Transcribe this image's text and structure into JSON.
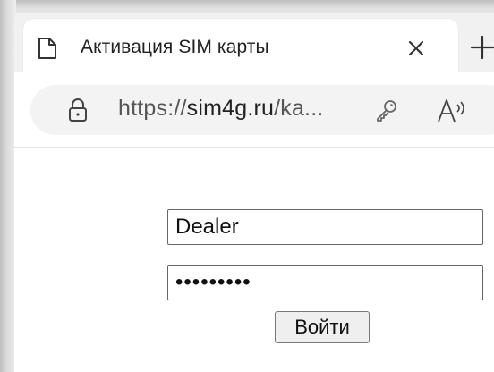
{
  "browser": {
    "tab": {
      "title": "Активация SIM карты",
      "favicon": "page-icon",
      "close_icon": "close-icon"
    },
    "new_tab_icon": "plus-icon",
    "address_bar": {
      "scheme": "https://",
      "host": "sim4g.ru",
      "path": "/ka...",
      "lock_icon": "lock-icon",
      "password_icon": "key-icon",
      "read_aloud_icon": "read-aloud-icon"
    }
  },
  "login_form": {
    "username_value": "Dealer",
    "password_value": "•••••••••",
    "submit_label": "Войти"
  }
}
